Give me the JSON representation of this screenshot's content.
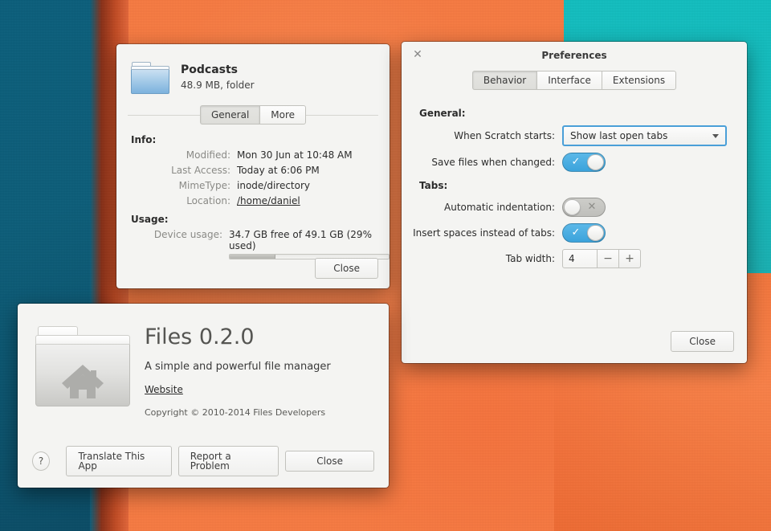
{
  "desktop": {
    "colors": {
      "teal_left": "#0c5c78",
      "teal_right": "#13c3c4",
      "pumpkin_orange": "#fb7d45",
      "pumpkin_shadow": "#c04a23"
    }
  },
  "properties_window": {
    "icon": "folder-icon",
    "title": "Podcasts",
    "subtitle": "48.9 MB, folder",
    "tabs": [
      {
        "label": "General",
        "active": true
      },
      {
        "label": "More",
        "active": false
      }
    ],
    "info_section_label": "Info:",
    "info_rows": [
      {
        "key": "Modified:",
        "value": "Mon 30 Jun at 10:48 AM",
        "link": false
      },
      {
        "key": "Last Access:",
        "value": "Today at 6:06 PM",
        "link": false
      },
      {
        "key": "MimeType:",
        "value": "inode/directory",
        "link": false
      },
      {
        "key": "Location:",
        "value": "/home/daniel",
        "link": true
      }
    ],
    "usage_section_label": "Usage:",
    "usage_row_key": "Device usage:",
    "usage_text": "34.7 GB free of 49.1 GB (29% used)",
    "usage_percent": 29,
    "close_label": "Close"
  },
  "preferences_window": {
    "close_icon": "close-icon",
    "title": "Preferences",
    "tabs": [
      {
        "label": "Behavior",
        "active": true
      },
      {
        "label": "Interface",
        "active": false
      },
      {
        "label": "Extensions",
        "active": false
      }
    ],
    "general_label": "General:",
    "startup_label": "When Scratch starts:",
    "startup_value": "Show last open tabs",
    "startup_options": [
      "Show last open tabs"
    ],
    "save_files_label": "Save files when changed:",
    "save_files_on": true,
    "tabs_label": "Tabs:",
    "auto_indent_label": "Automatic indentation:",
    "auto_indent_on": false,
    "insert_spaces_label": "Insert spaces instead of tabs:",
    "insert_spaces_on": true,
    "tab_width_label": "Tab width:",
    "tab_width_value": "4",
    "minus_label": "−",
    "plus_label": "+",
    "close_label": "Close"
  },
  "about_window": {
    "icon": "home-folder-icon",
    "app_name": "Files 0.2.0",
    "tagline": "A simple and powerful file manager",
    "website_label": "Website",
    "copyright": "Copyright © 2010-2014 Files Developers",
    "help_label": "?",
    "buttons": [
      {
        "label": "Translate This App"
      },
      {
        "label": "Report a Problem"
      },
      {
        "label": "Close"
      }
    ]
  }
}
